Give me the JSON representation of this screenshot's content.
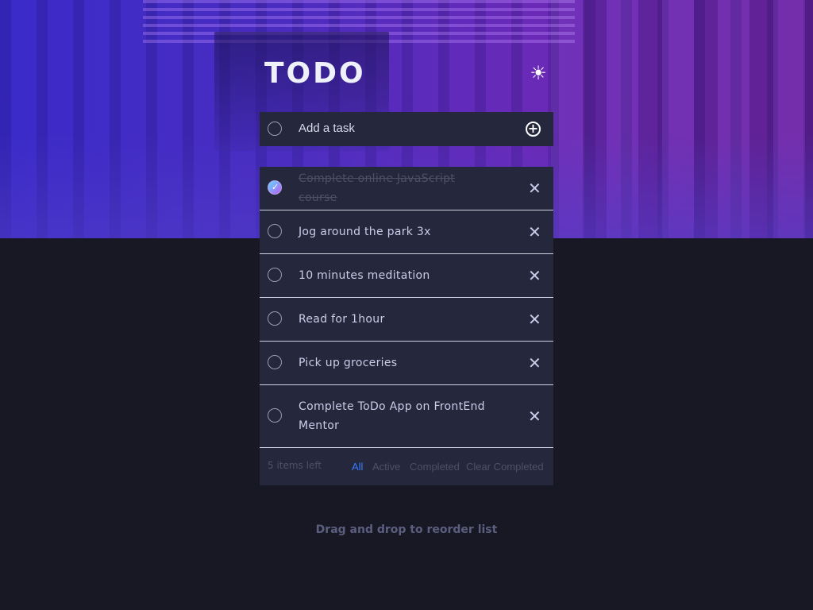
{
  "header": {
    "title": "TODO",
    "theme_icon": "sun-icon",
    "theme_glyph": "☀"
  },
  "new_task": {
    "placeholder": "Add a task",
    "add_icon": "plus-circle-icon",
    "add_glyph": "+"
  },
  "todos": [
    {
      "text": "Complete online JavaScript course",
      "completed": true
    },
    {
      "text": "Jog around the park 3x",
      "completed": false
    },
    {
      "text": "10 minutes meditation",
      "completed": false
    },
    {
      "text": "Read for 1hour",
      "completed": false
    },
    {
      "text": "Pick up groceries",
      "completed": false
    },
    {
      "text": "Complete ToDo App on FrontEnd Mentor",
      "completed": false
    }
  ],
  "delete_glyph": "✕",
  "check_glyph": "✓",
  "footer": {
    "items_left": "5 items left",
    "filters": {
      "all": "All",
      "active": "Active",
      "completed": "Completed"
    },
    "active_filter": "all",
    "clear_completed": "Clear Completed"
  },
  "hint": "Drag and drop to reorder list",
  "colors": {
    "accent": "#3a7bfd",
    "check_gradient_start": "#57ddff",
    "check_gradient_end": "#c058f3",
    "panel": "#25273d",
    "background": "#181824"
  }
}
